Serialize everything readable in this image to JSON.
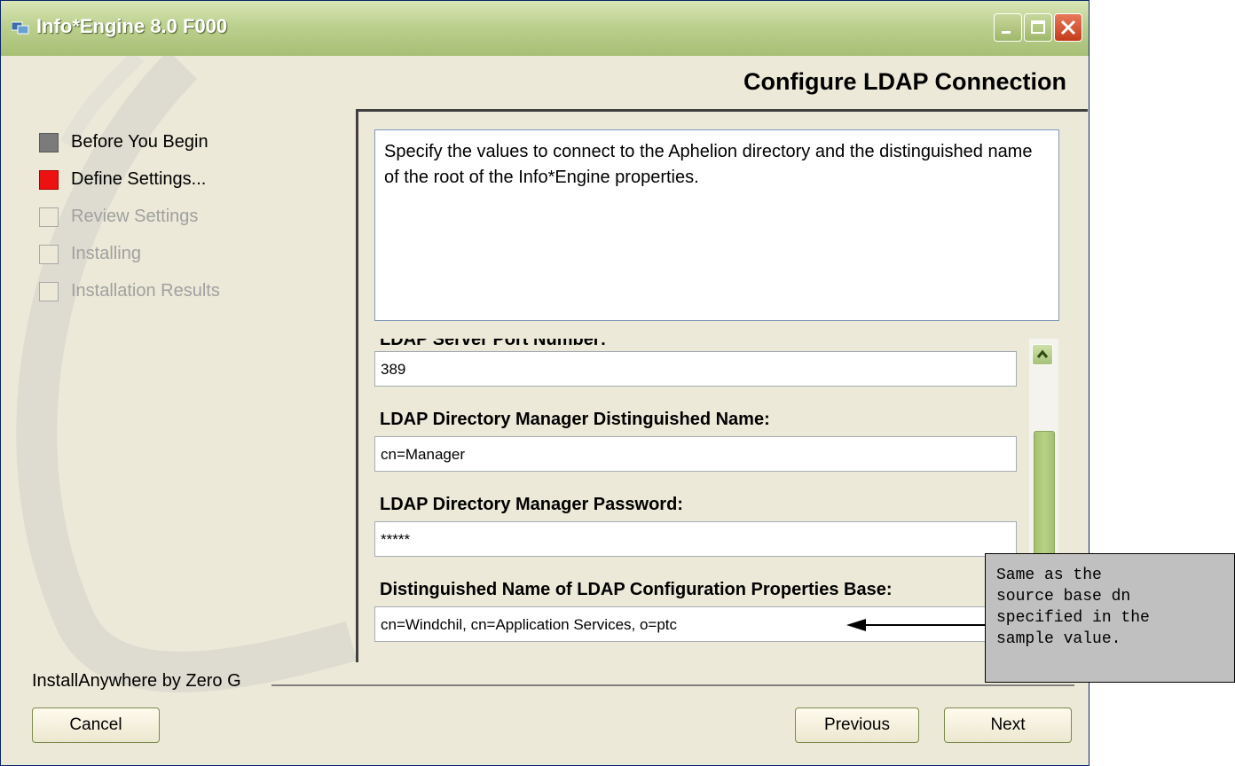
{
  "window": {
    "title": "Info*Engine 8.0 F000"
  },
  "page": {
    "heading": "Configure LDAP Connection"
  },
  "steps": [
    {
      "label": "Before You Begin",
      "state": "done"
    },
    {
      "label": "Define Settings...",
      "state": "current"
    },
    {
      "label": "Review Settings",
      "state": "pending"
    },
    {
      "label": "Installing",
      "state": "pending"
    },
    {
      "label": "Installation Results",
      "state": "pending"
    }
  ],
  "description": "Specify the  values to connect to the Aphelion directory and the distinguished name of the root of the Info*Engine properties.",
  "fields": [
    {
      "label": "LDAP Server Port Number:",
      "value": "389"
    },
    {
      "label": "LDAP Directory Manager Distinguished Name:",
      "value": "cn=Manager"
    },
    {
      "label": "LDAP Directory Manager Password:",
      "value": "*****"
    },
    {
      "label": "Distinguished Name of LDAP Configuration Properties Base:",
      "value": "cn=Windchil, cn=Application Services, o=ptc"
    }
  ],
  "footer": {
    "brand": "InstallAnywhere by Zero G"
  },
  "buttons": {
    "cancel": "Cancel",
    "previous": "Previous",
    "next": "Next"
  },
  "callout": {
    "text": "Same as the\nsource base dn\nspecified in the\nsample value."
  },
  "colors": {
    "titlebar": "#a7bf74",
    "current_step": "#ee1111",
    "done_step": "#7b7b7b"
  }
}
